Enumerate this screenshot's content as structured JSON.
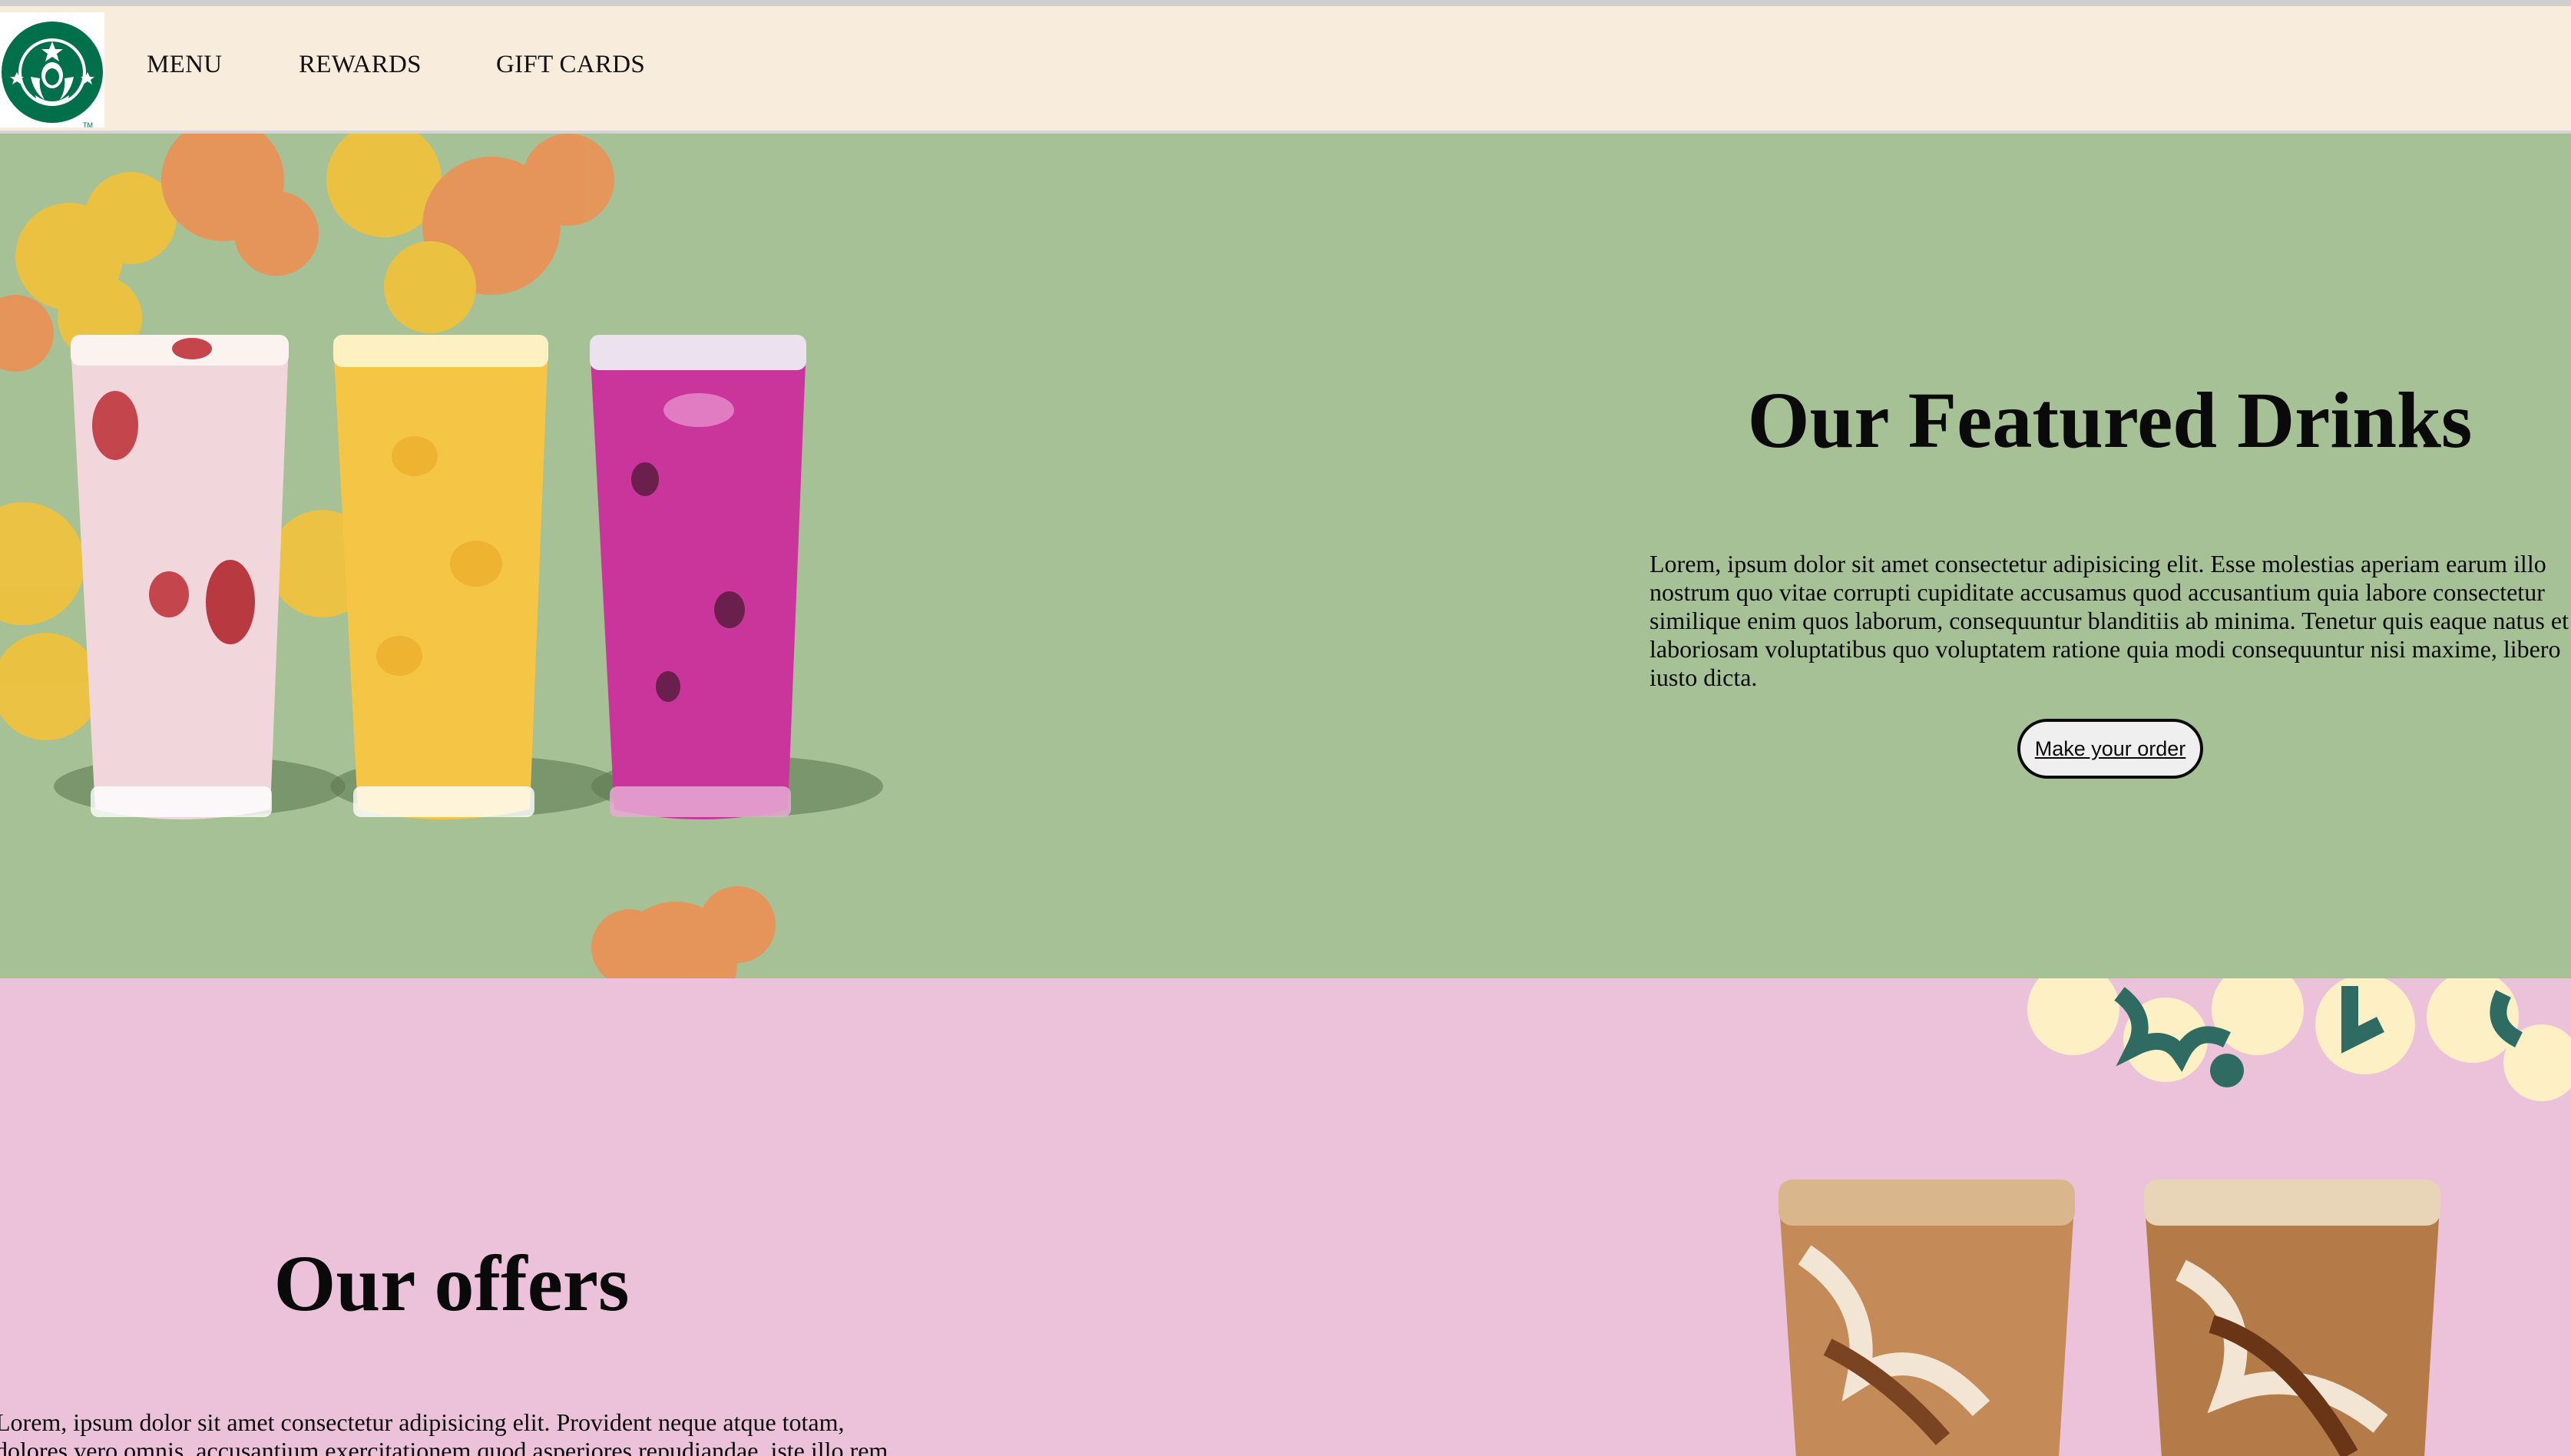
{
  "header": {
    "logo_icon": "starbucks-siren-logo-icon",
    "nav": {
      "menu": "MENU",
      "rewards": "REWARDS",
      "gift_cards": "GIFT CARDS"
    }
  },
  "featured": {
    "title": "Our Featured Drinks",
    "body": "Lorem, ipsum dolor sit amet consectetur adipisicing elit. Esse molestias aperiam earum illo nostrum quo vitae corrupti cupiditate accusamus quod accusantium quia labore consectetur similique enim quos laborum, consequuntur blanditiis ab minima. Tenetur quis eaque natus et laboriosam voluptatibus quo voluptatem ratione quia modi consequuntur nisi maxime, libero iusto dicta.",
    "button_label": "Make your order",
    "image": "three-iced-refresher-drinks-image"
  },
  "offers": {
    "title": "Our offers",
    "body": "Lorem, ipsum dolor sit amet consectetur adipisicing elit. Provident neque atque totam, dolores vero omnis, accusantium exercitationem quod asperiores repudiandae, iste illo rem",
    "image": "two-iced-coffee-drinks-image"
  },
  "colors": {
    "topbar": "#f8eddd",
    "featured_bg": "#a6c195",
    "offers_bg": "#ecc2db",
    "logo_green": "#00704a"
  }
}
